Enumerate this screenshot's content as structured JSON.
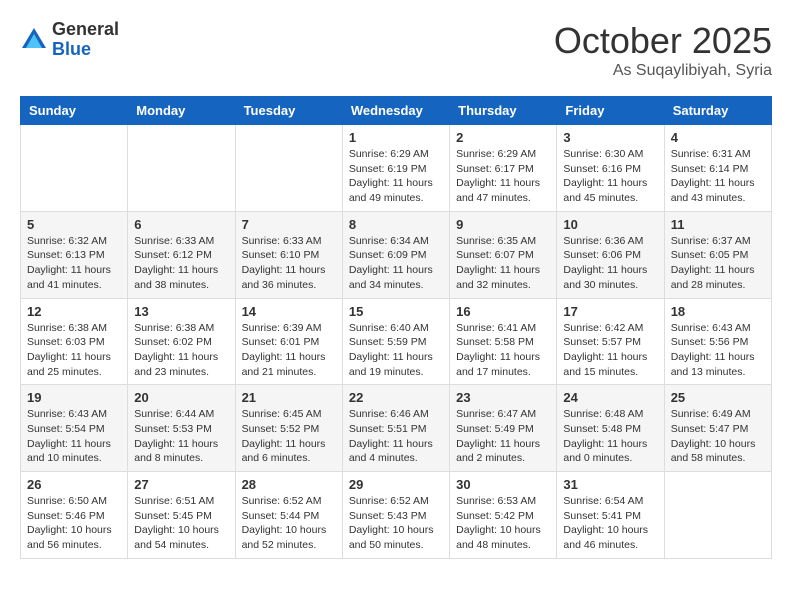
{
  "logo": {
    "general": "General",
    "blue": "Blue"
  },
  "title": {
    "month": "October 2025",
    "location": "As Suqaylibiyah, Syria"
  },
  "weekdays": [
    "Sunday",
    "Monday",
    "Tuesday",
    "Wednesday",
    "Thursday",
    "Friday",
    "Saturday"
  ],
  "weeks": [
    [
      {
        "day": "",
        "info": ""
      },
      {
        "day": "",
        "info": ""
      },
      {
        "day": "",
        "info": ""
      },
      {
        "day": "1",
        "info": "Sunrise: 6:29 AM\nSunset: 6:19 PM\nDaylight: 11 hours\nand 49 minutes."
      },
      {
        "day": "2",
        "info": "Sunrise: 6:29 AM\nSunset: 6:17 PM\nDaylight: 11 hours\nand 47 minutes."
      },
      {
        "day": "3",
        "info": "Sunrise: 6:30 AM\nSunset: 6:16 PM\nDaylight: 11 hours\nand 45 minutes."
      },
      {
        "day": "4",
        "info": "Sunrise: 6:31 AM\nSunset: 6:14 PM\nDaylight: 11 hours\nand 43 minutes."
      }
    ],
    [
      {
        "day": "5",
        "info": "Sunrise: 6:32 AM\nSunset: 6:13 PM\nDaylight: 11 hours\nand 41 minutes."
      },
      {
        "day": "6",
        "info": "Sunrise: 6:33 AM\nSunset: 6:12 PM\nDaylight: 11 hours\nand 38 minutes."
      },
      {
        "day": "7",
        "info": "Sunrise: 6:33 AM\nSunset: 6:10 PM\nDaylight: 11 hours\nand 36 minutes."
      },
      {
        "day": "8",
        "info": "Sunrise: 6:34 AM\nSunset: 6:09 PM\nDaylight: 11 hours\nand 34 minutes."
      },
      {
        "day": "9",
        "info": "Sunrise: 6:35 AM\nSunset: 6:07 PM\nDaylight: 11 hours\nand 32 minutes."
      },
      {
        "day": "10",
        "info": "Sunrise: 6:36 AM\nSunset: 6:06 PM\nDaylight: 11 hours\nand 30 minutes."
      },
      {
        "day": "11",
        "info": "Sunrise: 6:37 AM\nSunset: 6:05 PM\nDaylight: 11 hours\nand 28 minutes."
      }
    ],
    [
      {
        "day": "12",
        "info": "Sunrise: 6:38 AM\nSunset: 6:03 PM\nDaylight: 11 hours\nand 25 minutes."
      },
      {
        "day": "13",
        "info": "Sunrise: 6:38 AM\nSunset: 6:02 PM\nDaylight: 11 hours\nand 23 minutes."
      },
      {
        "day": "14",
        "info": "Sunrise: 6:39 AM\nSunset: 6:01 PM\nDaylight: 11 hours\nand 21 minutes."
      },
      {
        "day": "15",
        "info": "Sunrise: 6:40 AM\nSunset: 5:59 PM\nDaylight: 11 hours\nand 19 minutes."
      },
      {
        "day": "16",
        "info": "Sunrise: 6:41 AM\nSunset: 5:58 PM\nDaylight: 11 hours\nand 17 minutes."
      },
      {
        "day": "17",
        "info": "Sunrise: 6:42 AM\nSunset: 5:57 PM\nDaylight: 11 hours\nand 15 minutes."
      },
      {
        "day": "18",
        "info": "Sunrise: 6:43 AM\nSunset: 5:56 PM\nDaylight: 11 hours\nand 13 minutes."
      }
    ],
    [
      {
        "day": "19",
        "info": "Sunrise: 6:43 AM\nSunset: 5:54 PM\nDaylight: 11 hours\nand 10 minutes."
      },
      {
        "day": "20",
        "info": "Sunrise: 6:44 AM\nSunset: 5:53 PM\nDaylight: 11 hours\nand 8 minutes."
      },
      {
        "day": "21",
        "info": "Sunrise: 6:45 AM\nSunset: 5:52 PM\nDaylight: 11 hours\nand 6 minutes."
      },
      {
        "day": "22",
        "info": "Sunrise: 6:46 AM\nSunset: 5:51 PM\nDaylight: 11 hours\nand 4 minutes."
      },
      {
        "day": "23",
        "info": "Sunrise: 6:47 AM\nSunset: 5:49 PM\nDaylight: 11 hours\nand 2 minutes."
      },
      {
        "day": "24",
        "info": "Sunrise: 6:48 AM\nSunset: 5:48 PM\nDaylight: 11 hours\nand 0 minutes."
      },
      {
        "day": "25",
        "info": "Sunrise: 6:49 AM\nSunset: 5:47 PM\nDaylight: 10 hours\nand 58 minutes."
      }
    ],
    [
      {
        "day": "26",
        "info": "Sunrise: 6:50 AM\nSunset: 5:46 PM\nDaylight: 10 hours\nand 56 minutes."
      },
      {
        "day": "27",
        "info": "Sunrise: 6:51 AM\nSunset: 5:45 PM\nDaylight: 10 hours\nand 54 minutes."
      },
      {
        "day": "28",
        "info": "Sunrise: 6:52 AM\nSunset: 5:44 PM\nDaylight: 10 hours\nand 52 minutes."
      },
      {
        "day": "29",
        "info": "Sunrise: 6:52 AM\nSunset: 5:43 PM\nDaylight: 10 hours\nand 50 minutes."
      },
      {
        "day": "30",
        "info": "Sunrise: 6:53 AM\nSunset: 5:42 PM\nDaylight: 10 hours\nand 48 minutes."
      },
      {
        "day": "31",
        "info": "Sunrise: 6:54 AM\nSunset: 5:41 PM\nDaylight: 10 hours\nand 46 minutes."
      },
      {
        "day": "",
        "info": ""
      }
    ]
  ]
}
